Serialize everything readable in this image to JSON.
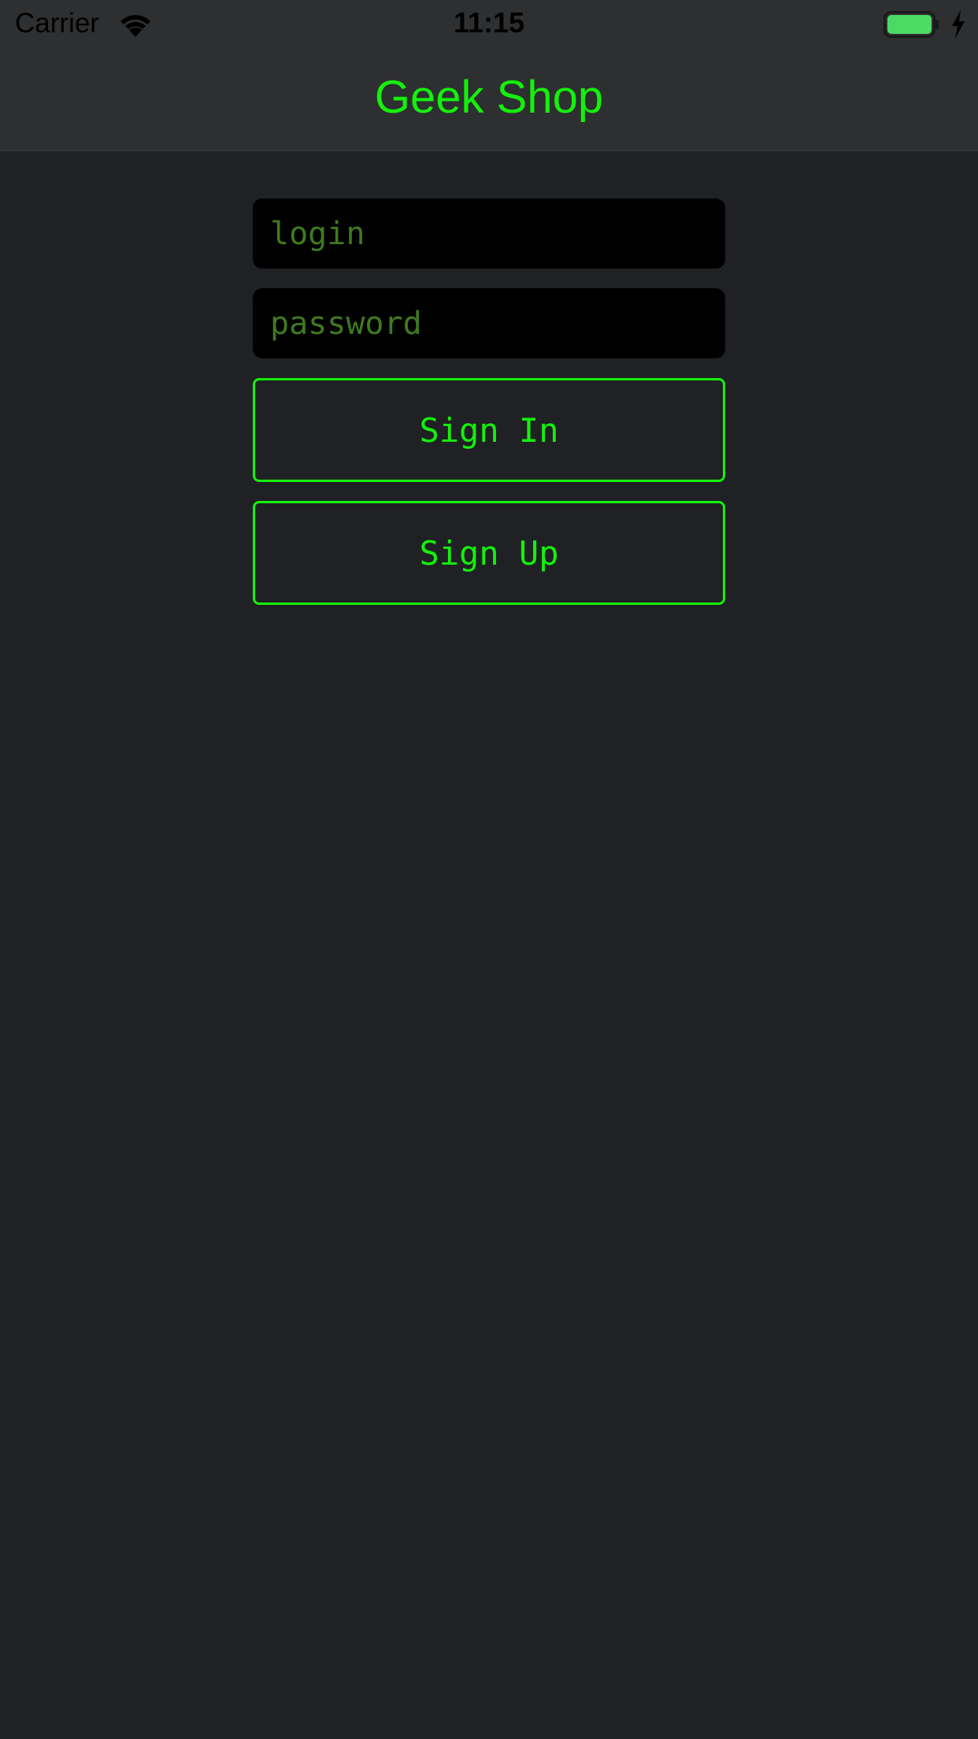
{
  "status_bar": {
    "carrier": "Carrier",
    "time": "11:15",
    "battery_color": "#4cd964"
  },
  "nav": {
    "title": "Geek Shop"
  },
  "form": {
    "login_placeholder": "login",
    "login_value": "",
    "password_placeholder": "password",
    "password_value": "",
    "sign_in_label": "Sign In",
    "sign_up_label": "Sign Up"
  },
  "colors": {
    "accent": "#14f10b",
    "placeholder": "#3f7a1f",
    "background": "#202124",
    "bar": "#2e2f31",
    "field": "#000000"
  },
  "icons": [
    "wifi-icon",
    "battery-icon",
    "charging-bolt-icon"
  ]
}
